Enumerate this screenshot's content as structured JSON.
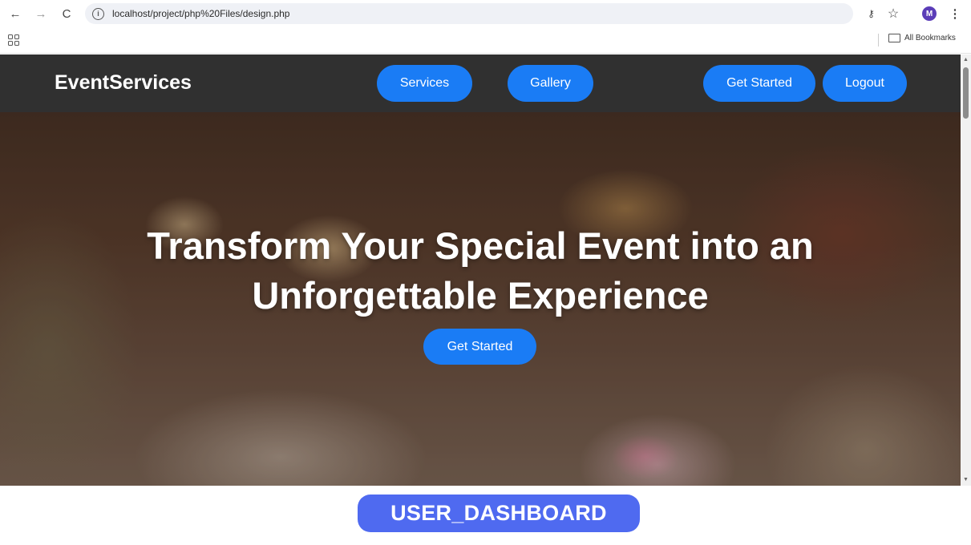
{
  "browser": {
    "url": "localhost/project/php%20Files/design.php",
    "back_icon": "←",
    "forward_icon": "→",
    "reload_icon": "C",
    "key_icon": "⚷",
    "star_icon": "☆",
    "avatar_letter": "M",
    "menu_icon": "⋮",
    "all_bookmarks": "All Bookmarks"
  },
  "site": {
    "brand": "EventServices",
    "nav": {
      "services": "Services",
      "gallery": "Gallery",
      "get_started": "Get Started",
      "logout": "Logout"
    },
    "hero": {
      "title_line1": "Transform Your Special Event into an",
      "title_line2": "Unforgettable Experience",
      "cta": "Get Started"
    }
  },
  "caption": "USER_DASHBOARD",
  "colors": {
    "nav_bg": "#303030",
    "button_blue": "#1a7cf5",
    "caption_bg": "#4f6af0"
  }
}
